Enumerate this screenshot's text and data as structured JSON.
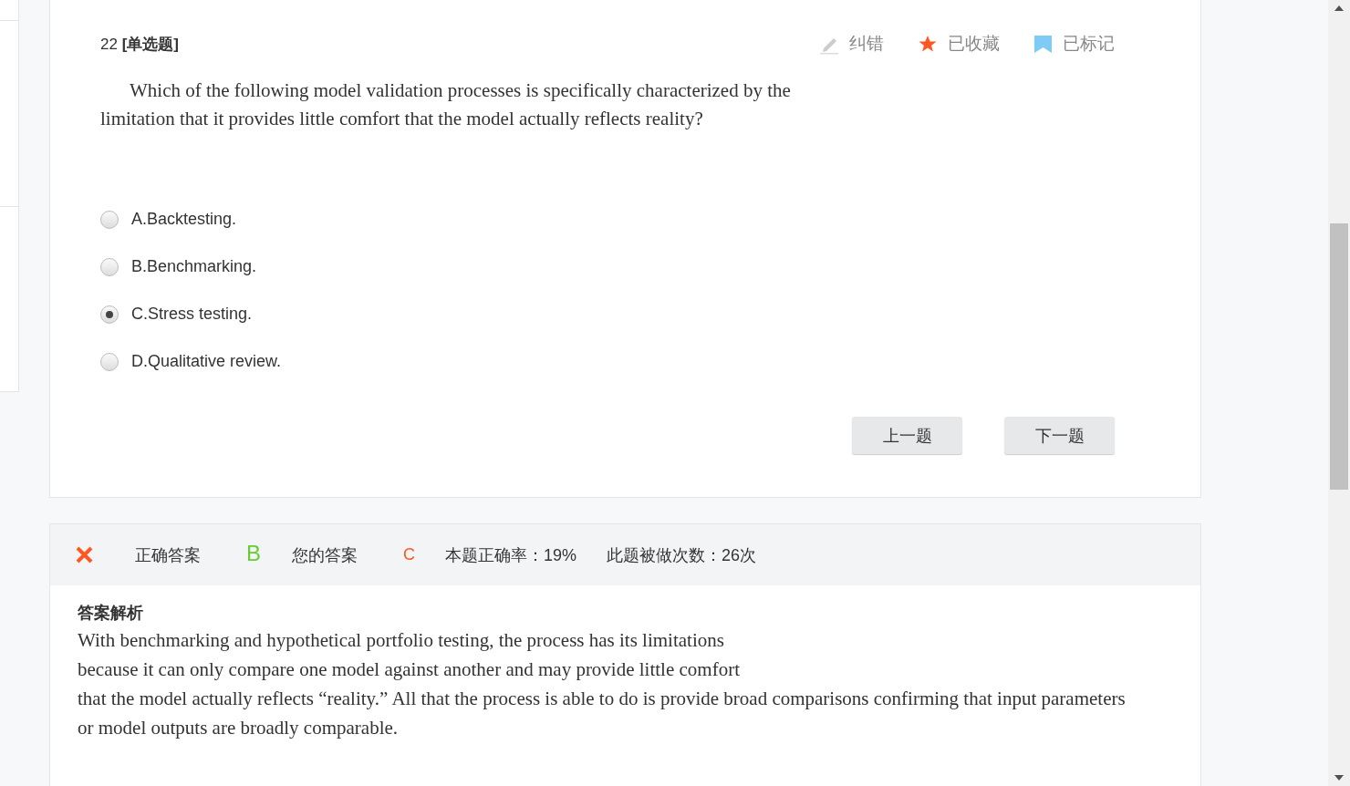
{
  "question": {
    "title": "22 **[单选题]**",
    "tools": [
      {
        "kind": "pencil",
        "label": "纠错",
        "on": false
      },
      {
        "kind": "star",
        "label": "已收藏",
        "on": true
      },
      {
        "kind": "bookmark",
        "label": "已标记",
        "on": true
      }
    ],
    "text": "Which of the following model validation processes is specifically characterized by the\nlimitation that it provides little comfort that the model actually reflects reality?",
    "options": [
      {
        "label": "A.Backtesting.",
        "selected": false
      },
      {
        "label": "B.Benchmarking.",
        "selected": false
      },
      {
        "label": "C.Stress testing.",
        "selected": true
      },
      {
        "label": "D.Qualitative review.",
        "selected": false
      }
    ],
    "buttons": [
      "上一题",
      "下一题"
    ]
  },
  "result": {
    "correct": false,
    "correct_answer_label": "正确答案",
    "correct_answer": "B",
    "your_answer_label": "您的答案",
    "your_answer": "C",
    "accuracy": "本题正确率：19%",
    "attempts": "此题被做次数：26次",
    "explanation_title": "答案解析",
    "explanation": "With benchmarking and hypothetical portfolio testing, the process has its limitations\nbecause it can only compare one model against another and may provide little comfort\nthat the model actually reflects “reality.” All that the process is able to do is provide broad comparisons confirming that input parameters\nor model outputs are broadly comparable."
  }
}
